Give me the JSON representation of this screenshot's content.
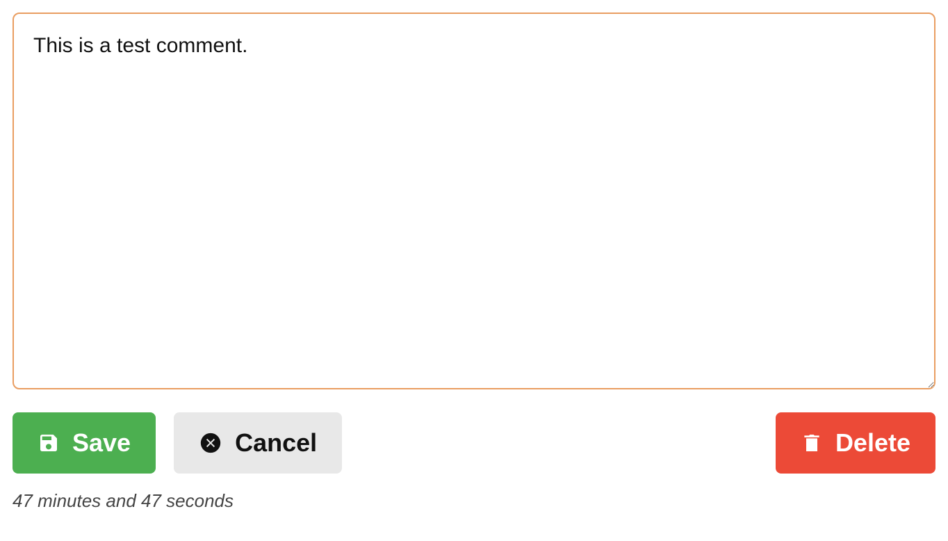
{
  "comment": {
    "text": "This is a test comment."
  },
  "buttons": {
    "save": "Save",
    "cancel": "Cancel",
    "delete": "Delete"
  },
  "timestamp": "47 minutes and 47 seconds"
}
